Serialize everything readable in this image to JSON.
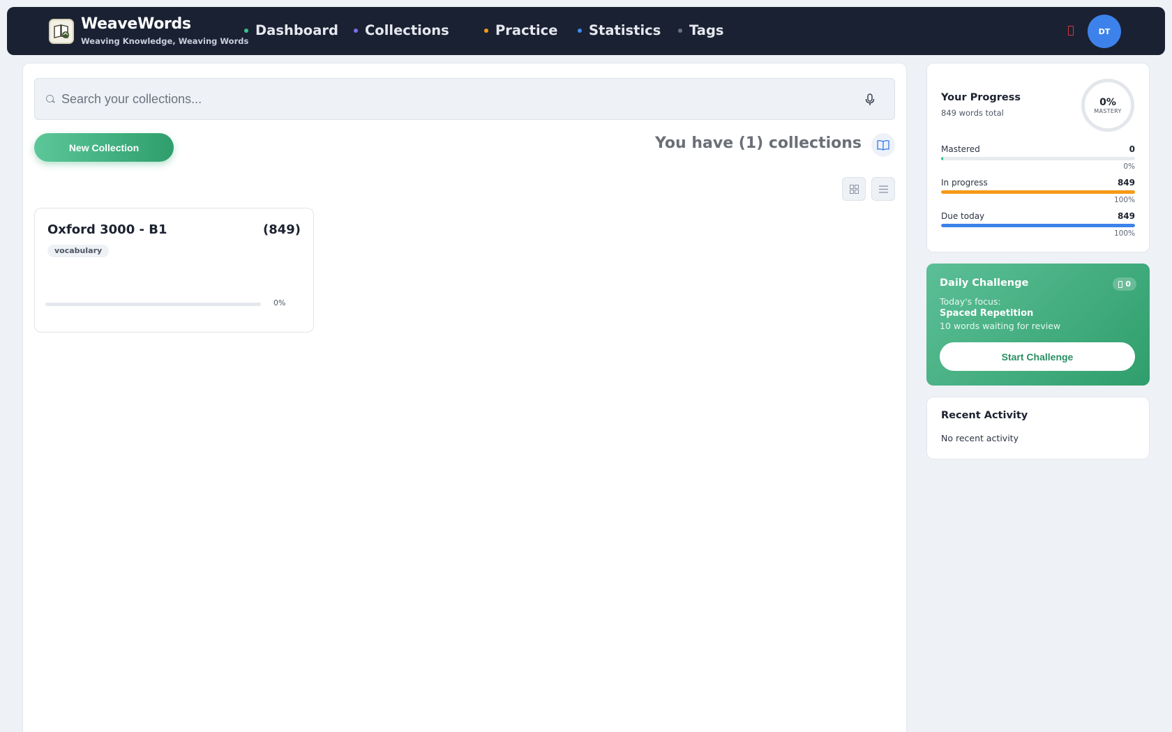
{
  "brand": {
    "title": "WeaveWords",
    "subtitle": "Weaving Knowledge, Weaving Words"
  },
  "nav": [
    {
      "label": "Dashboard",
      "dot": "#36c28a"
    },
    {
      "label": "Collections",
      "dot": "#7b6df0"
    },
    {
      "label": "Practice",
      "dot": "#f59a16"
    },
    {
      "label": "Statistics",
      "dot": "#3d8cf0"
    },
    {
      "label": "Tags",
      "dot": "#6b7280"
    }
  ],
  "user": {
    "initials": "DT",
    "bell_icon": "bell-icon"
  },
  "search": {
    "placeholder": "Search your collections...",
    "value": ""
  },
  "toolbar": {
    "new_label": "New Collection",
    "count_text": "You have (1) collections"
  },
  "collections": [
    {
      "title": "Oxford 3000 - B1",
      "count": "(849)",
      "tag": "vocabulary",
      "progress": 0,
      "progress_text": "0%"
    }
  ],
  "progress": {
    "title": "Your Progress",
    "subtitle": "849 words total",
    "mastery_value": "0%",
    "mastery_label": "MASTERY",
    "stats": [
      {
        "label": "Mastered",
        "value": "0",
        "pct": "0%",
        "fill": 0.01,
        "color": "#36c28a"
      },
      {
        "label": "In progress",
        "value": "849",
        "pct": "100%",
        "fill": 1.0,
        "color": "#f59a16"
      },
      {
        "label": "Due today",
        "value": "849",
        "pct": "100%",
        "fill": 1.0,
        "color": "#3d82ea"
      }
    ]
  },
  "challenge": {
    "title": "Daily Challenge",
    "badge": "0",
    "focus_label": "Today's focus:",
    "focus": "Spaced Repetition",
    "desc": "10 words waiting for review",
    "button": "Start Challenge"
  },
  "activity": {
    "title": "Recent Activity",
    "empty": "No recent activity"
  }
}
